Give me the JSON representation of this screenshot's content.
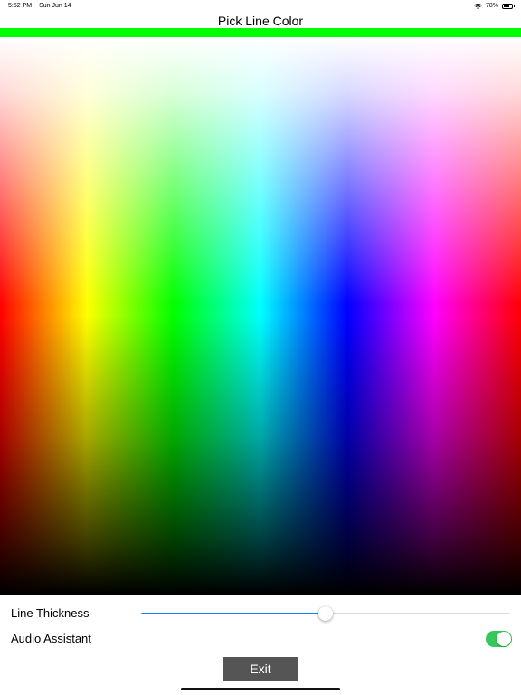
{
  "status_bar": {
    "time": "5:52 PM",
    "date": "Sun Jun 14",
    "battery_text": "78%",
    "battery_level": 0.78,
    "wifi_icon": "wifi-icon",
    "battery_icon": "battery-icon"
  },
  "title": "Pick Line Color",
  "selected_color": "#00ff00",
  "picker_colors": [
    "#ff0000",
    "#ffff00",
    "#00ff00",
    "#00ffff",
    "#0000ff",
    "#ff00ff"
  ],
  "line_thickness": {
    "label": "Line Thickness",
    "value": 0.5,
    "accent": "#1a7ef5"
  },
  "audio_assistant": {
    "label": "Audio Assistant",
    "enabled": true,
    "accent": "#34c759"
  },
  "exit_button": {
    "label": "Exit",
    "color": "#555555"
  }
}
